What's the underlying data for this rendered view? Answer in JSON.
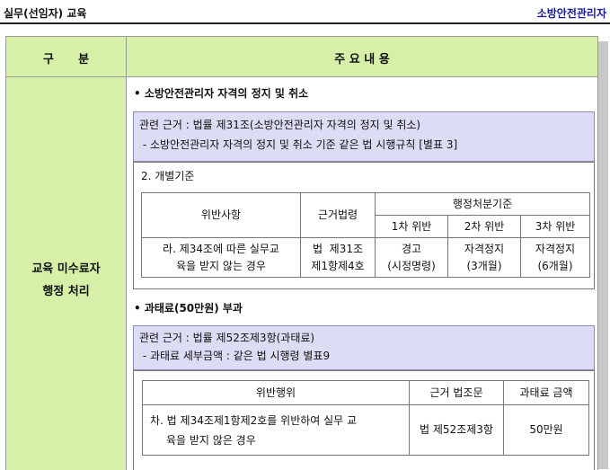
{
  "header": {
    "left": "실무(선임자) 교육",
    "right": "소방안전관리자"
  },
  "table_head": {
    "col1": "구      분",
    "col2": "주 요 내 용"
  },
  "row_label": {
    "line1": "교육 미수료자",
    "line2": "행정 처리"
  },
  "section1": {
    "title": "• 소방안전관리자 자격의 정지 및 취소",
    "basis_line1": "관련 근거 : 법률 제31조(소방안전관리자 자격의 정지 및 취소)",
    "basis_line2": " - 소방안전관리자 자격의 정지 및 취소 기준 같은 법 시행규칙 [별표 3]",
    "sub_label": "2. 개별기준",
    "table": {
      "h_violation": "위반사항",
      "h_law": "근거법령",
      "h_disposition": "행정처분기준",
      "h_first": "1차 위반",
      "h_second": "2차 위반",
      "h_third": "3차 위반",
      "violation_l1": "라. 제34조에 따른 실무교",
      "violation_l2": "육을 받지 않는 경우",
      "law_l1": "법  제31조",
      "law_l2": "제1항제4호",
      "first_l1": "경고",
      "first_l2": "(시정명령)",
      "second_l1": "자격정지",
      "second_l2": "(3개월)",
      "third_l1": "자격정지",
      "third_l2": "(6개월)"
    }
  },
  "section2": {
    "title": "• 과태료(50만원) 부과",
    "basis_line1": "관련 근거 : 법률 제52조제3항(과태료)",
    "basis_line2": " - 과태료 세부금액 : 같은 법 시행령 별표9",
    "table": {
      "h_act": "위반행위",
      "h_law": "근거 법조문",
      "h_fine": "과태료 금액",
      "act_l1": "차. 법 제34조제1항제2호를 위반하여 실무 교",
      "act_l2": "육을 받지 않은 경우",
      "law": "법 제52조제3항",
      "fine": "50만원"
    }
  }
}
